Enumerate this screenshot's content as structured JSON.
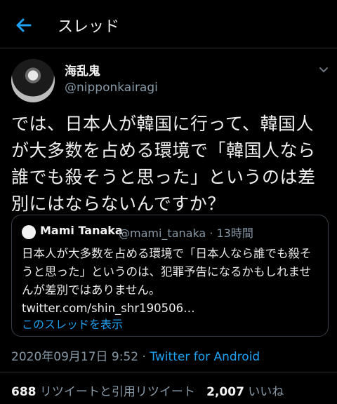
{
  "header": {
    "title": "スレッド"
  },
  "tweet": {
    "author_name": "海乱鬼",
    "author_handle": "@nipponkairagi",
    "text": "では、日本人が韓国に行って、韓国人が大多数を占める環境で「韓国人なら誰でも殺そうと思った」というのは差別にはならないんですか？",
    "timestamp": "2020年09月17日 9:52",
    "separator": " · ",
    "source": "Twitter for Android"
  },
  "quote": {
    "author_name": "Mami Tanaka",
    "author_handle": "@mami_tanaka · 13時間",
    "text": "日本人が大多数を占める環境で「日本人なら誰でも殺そうと思った」というのは、犯罪予告になるかもしれませんが差別ではありません。 twitter.com/shin_shr190506…",
    "thread_link": "このスレッドを表示"
  },
  "stats": {
    "retweets_count": "688",
    "retweets_label": "リツイートと引用リツイート",
    "likes_count": "2,007",
    "likes_label": "いいね"
  },
  "colors": {
    "accent": "#1da1f2",
    "muted": "#8899a6",
    "background": "#000000"
  }
}
